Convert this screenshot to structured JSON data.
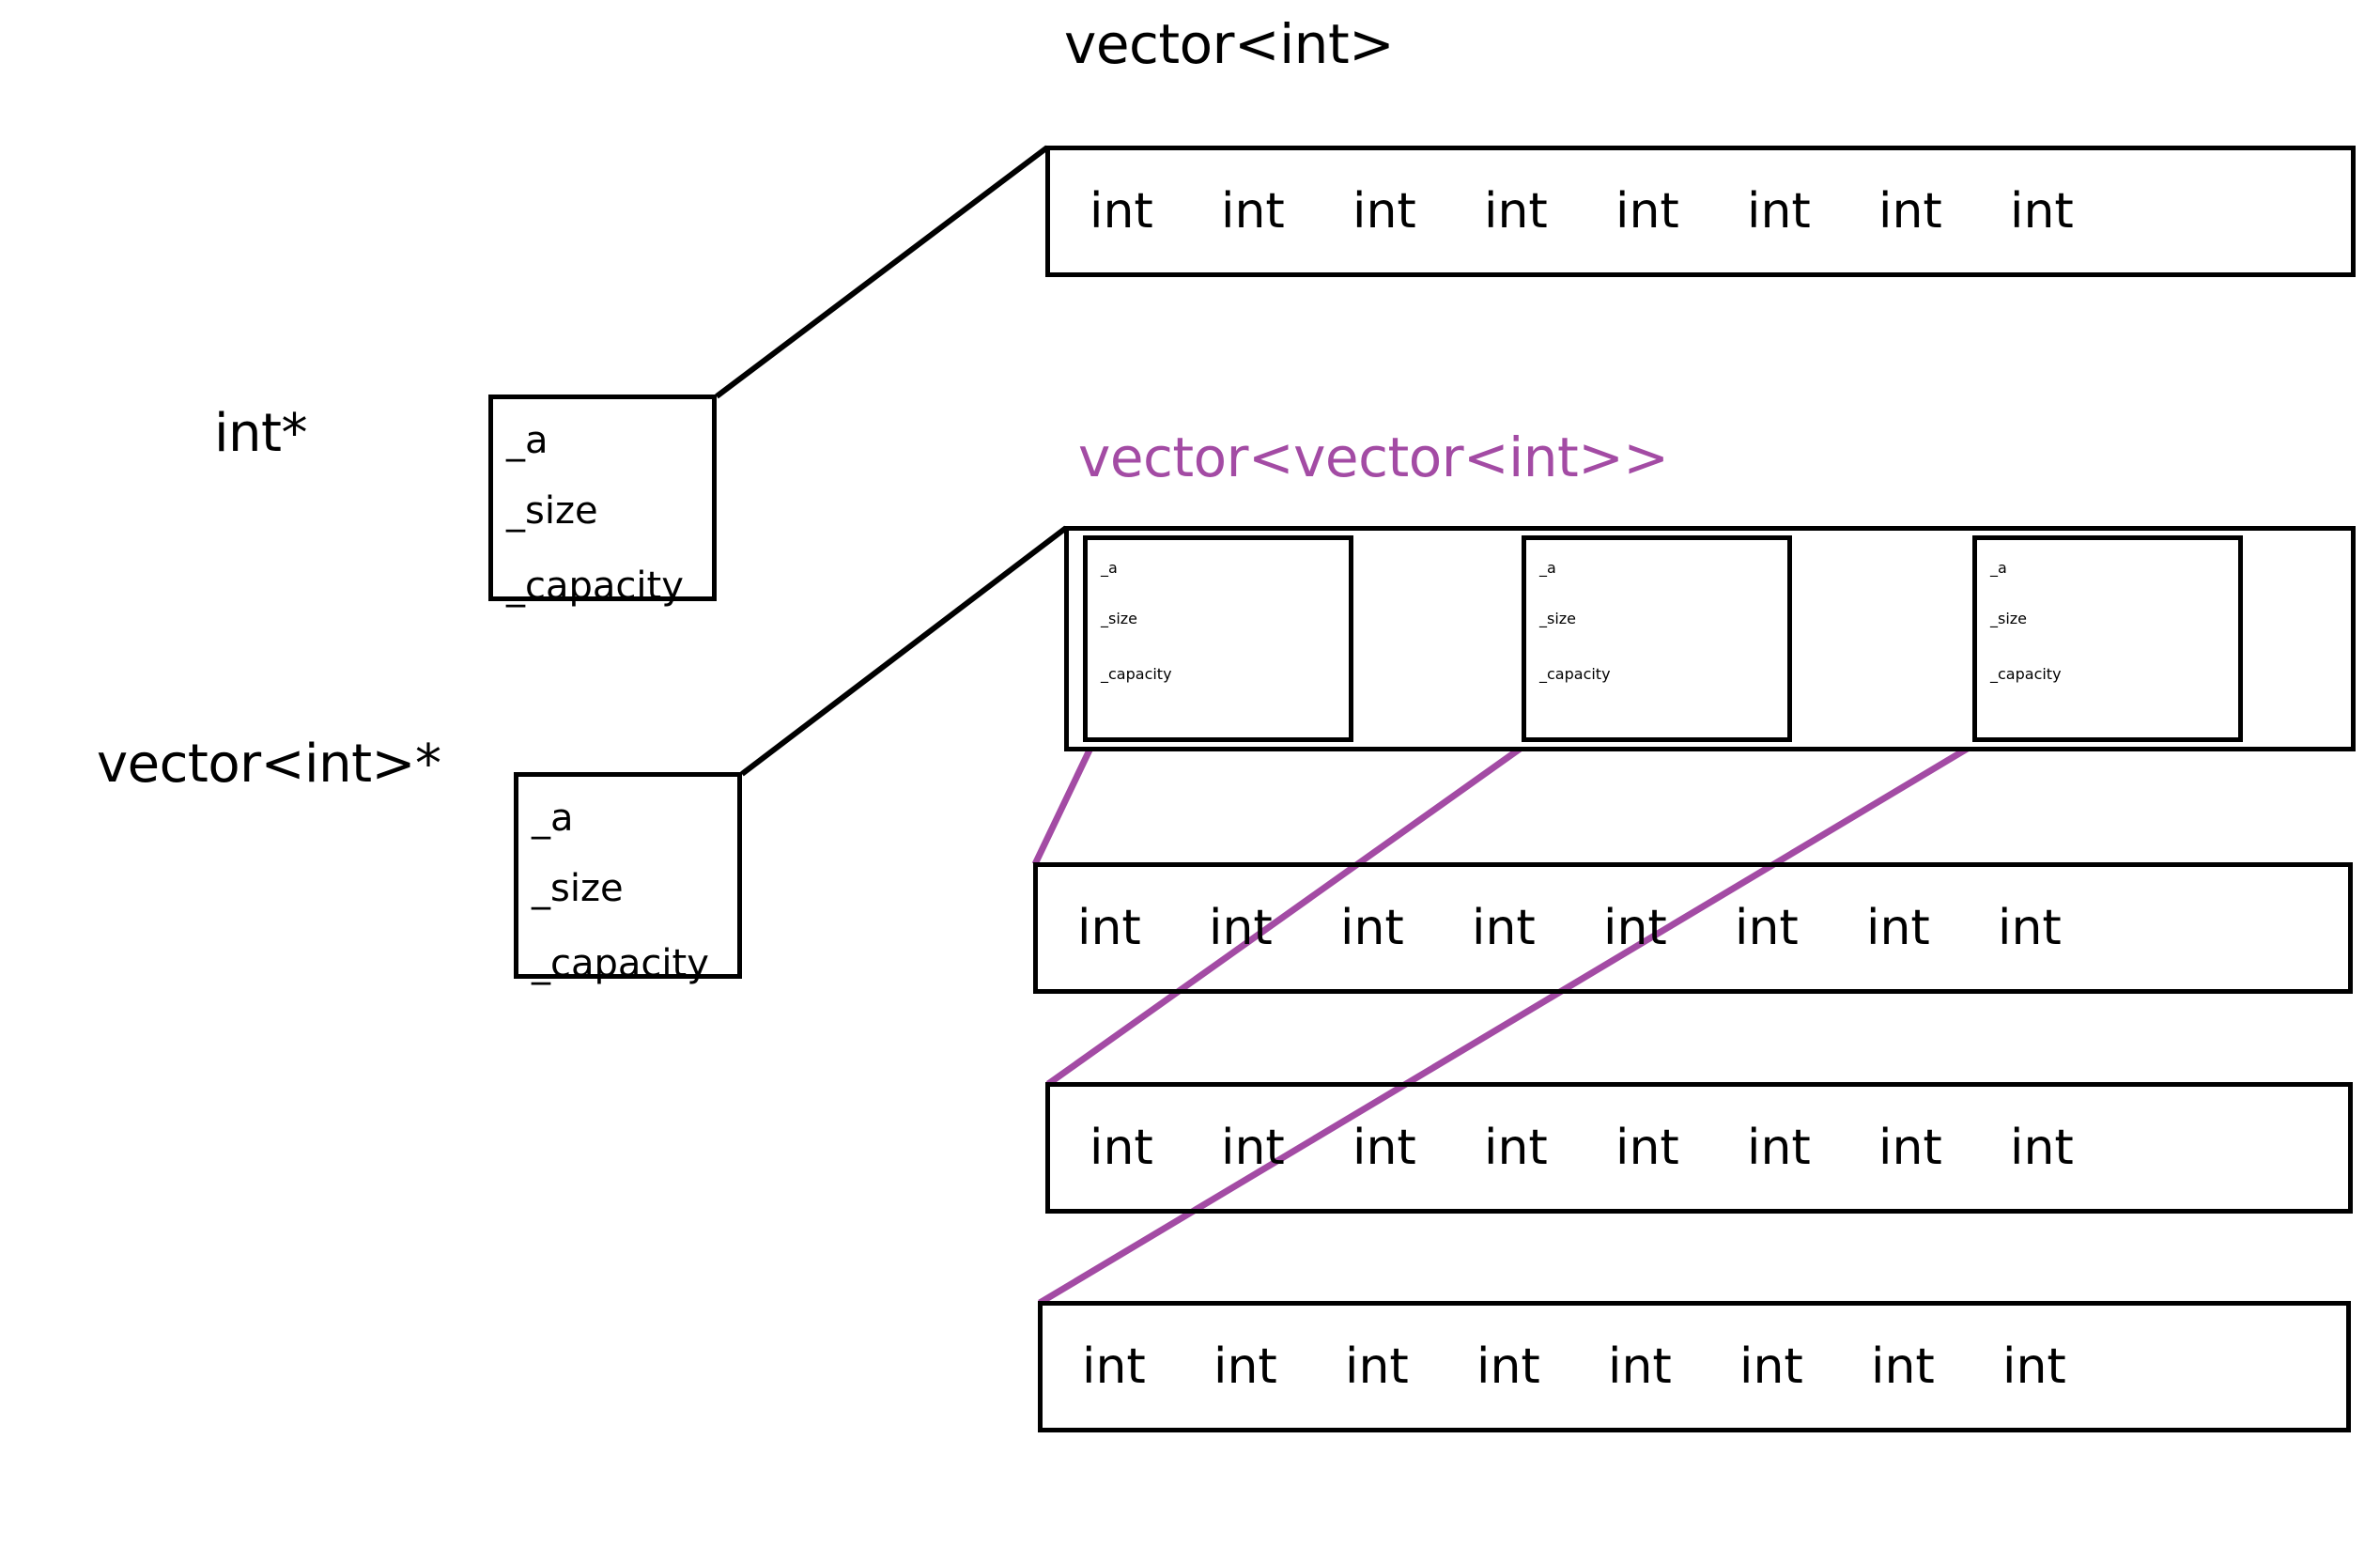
{
  "diagram": {
    "title_top": "vector<int>",
    "title_nested": "vector<vector<int>>",
    "accent_color": "#a34ba4",
    "line_color": "#000000"
  },
  "labels": {
    "int_pointer": "int*",
    "vector_int_pointer": "vector<int>*"
  },
  "struct_fields": {
    "a": "_a",
    "size": "_size",
    "capacity": "_capacity"
  },
  "structs": [
    {
      "name": "int-pointer-struct",
      "fields": [
        "_a",
        "_size",
        "_capacity"
      ]
    },
    {
      "name": "vector-int-pointer-struct",
      "fields": [
        "_a",
        "_size",
        "_capacity"
      ]
    }
  ],
  "nested_structs": [
    {
      "name": "inner-vector-0",
      "fields": [
        "_a",
        "_size",
        "_capacity"
      ]
    },
    {
      "name": "inner-vector-1",
      "fields": [
        "_a",
        "_size",
        "_capacity"
      ]
    },
    {
      "name": "inner-vector-2",
      "fields": [
        "_a",
        "_size",
        "_capacity"
      ]
    }
  ],
  "cell_label": "int",
  "array_rows": [
    {
      "name": "vector-int-buffer",
      "cells": [
        "int",
        "int",
        "int",
        "int",
        "int",
        "int",
        "int",
        "int"
      ]
    },
    {
      "name": "inner-buffer-0",
      "cells": [
        "int",
        "int",
        "int",
        "int",
        "int",
        "int",
        "int",
        "int"
      ]
    },
    {
      "name": "inner-buffer-1",
      "cells": [
        "int",
        "int",
        "int",
        "int",
        "int",
        "int",
        "int",
        "int"
      ]
    },
    {
      "name": "inner-buffer-2",
      "cells": [
        "int",
        "int",
        "int",
        "int",
        "int",
        "int",
        "int",
        "int"
      ]
    }
  ]
}
